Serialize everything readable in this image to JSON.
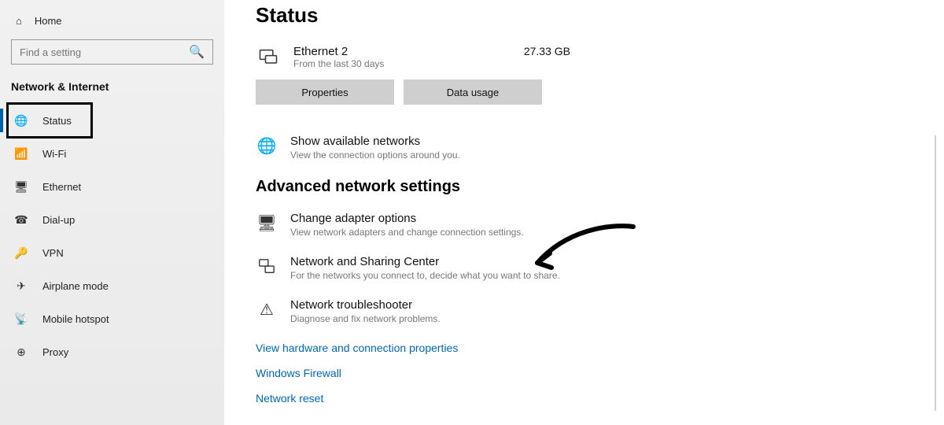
{
  "sidebar": {
    "home": "Home",
    "search_placeholder": "Find a setting",
    "section": "Network & Internet",
    "items": [
      {
        "icon": "🌐",
        "label": "Status",
        "selected": true
      },
      {
        "icon": "📶",
        "label": "Wi-Fi"
      },
      {
        "icon": "🖥",
        "label": "Ethernet"
      },
      {
        "icon": "☎",
        "label": "Dial-up"
      },
      {
        "icon": "🔑",
        "label": "VPN"
      },
      {
        "icon": "✈",
        "label": "Airplane mode"
      },
      {
        "icon": "📡",
        "label": "Mobile hotspot"
      },
      {
        "icon": "⊕",
        "label": "Proxy"
      }
    ]
  },
  "main": {
    "title": "Status",
    "network": {
      "name": "Ethernet 2",
      "sub": "From the last 30 days",
      "usage": "27.33 GB"
    },
    "buttons": {
      "properties": "Properties",
      "data_usage": "Data usage"
    },
    "available": {
      "title": "Show available networks",
      "sub": "View the connection options around you."
    },
    "advanced_heading": "Advanced network settings",
    "adapter": {
      "title": "Change adapter options",
      "sub": "View network adapters and change connection settings."
    },
    "sharing": {
      "title": "Network and Sharing Center",
      "sub": "For the networks you connect to, decide what you want to share."
    },
    "troubleshoot": {
      "title": "Network troubleshooter",
      "sub": "Diagnose and fix network problems."
    },
    "links": {
      "hw": "View hardware and connection properties",
      "firewall": "Windows Firewall",
      "reset": "Network reset"
    }
  }
}
